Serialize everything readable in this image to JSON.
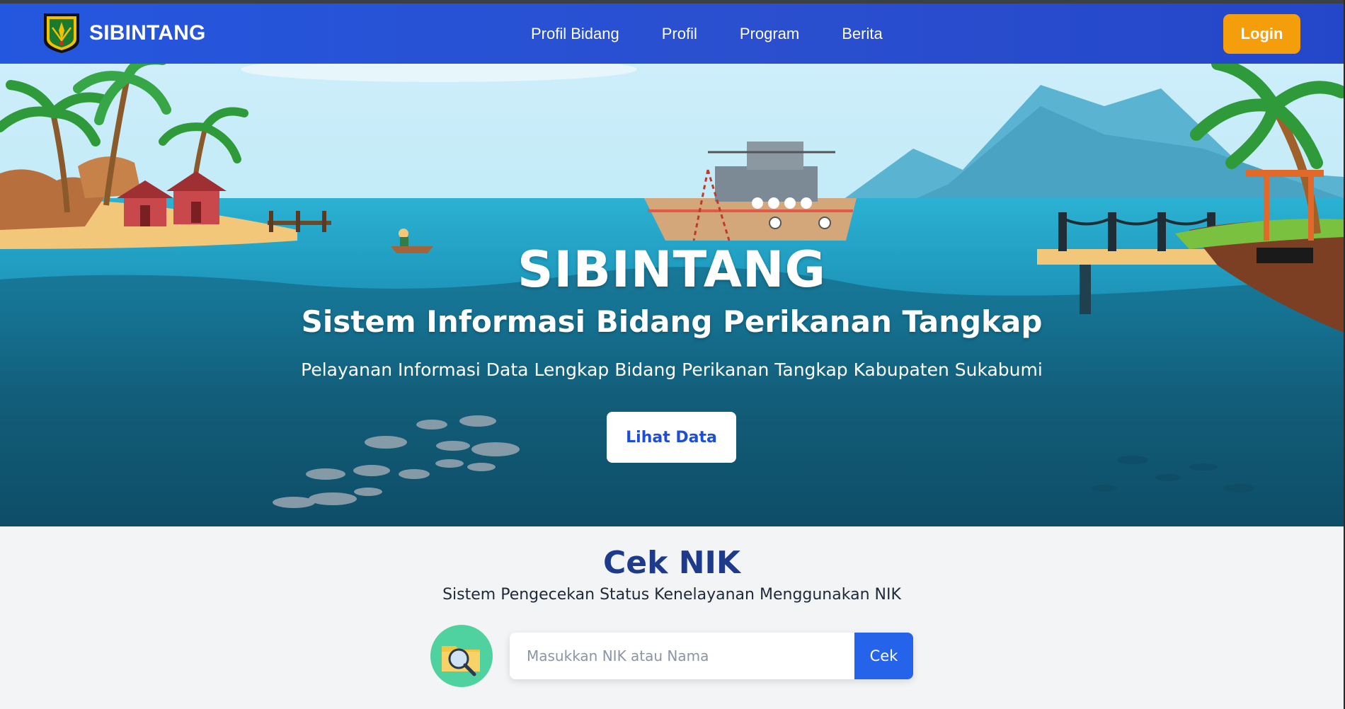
{
  "nav": {
    "brand": "SIBINTANG",
    "links": [
      "Profil Bidang",
      "Profil",
      "Program",
      "Berita"
    ],
    "login_label": "Login"
  },
  "hero": {
    "title": "SIBINTANG",
    "subtitle": "Sistem Informasi Bidang Perikanan Tangkap",
    "description": "Pelayanan Informasi Data Lengkap Bidang Perikanan Tangkap Kabupaten Sukabumi",
    "button_label": "Lihat Data"
  },
  "cek_nik": {
    "title": "Cek NIK",
    "subtitle": "Sistem Pengecekan Status Kenelayanan Menggunakan NIK",
    "placeholder": "Masukkan NIK atau Nama",
    "value": "",
    "button_label": "Cek"
  },
  "colors": {
    "nav": "#2457df",
    "login": "#f59e0b",
    "cek_title": "#1e3a8a",
    "cek_button": "#2563eb"
  },
  "icons": {
    "logo": "sukabumi-emblem-icon",
    "cek": "folder-search-icon"
  }
}
